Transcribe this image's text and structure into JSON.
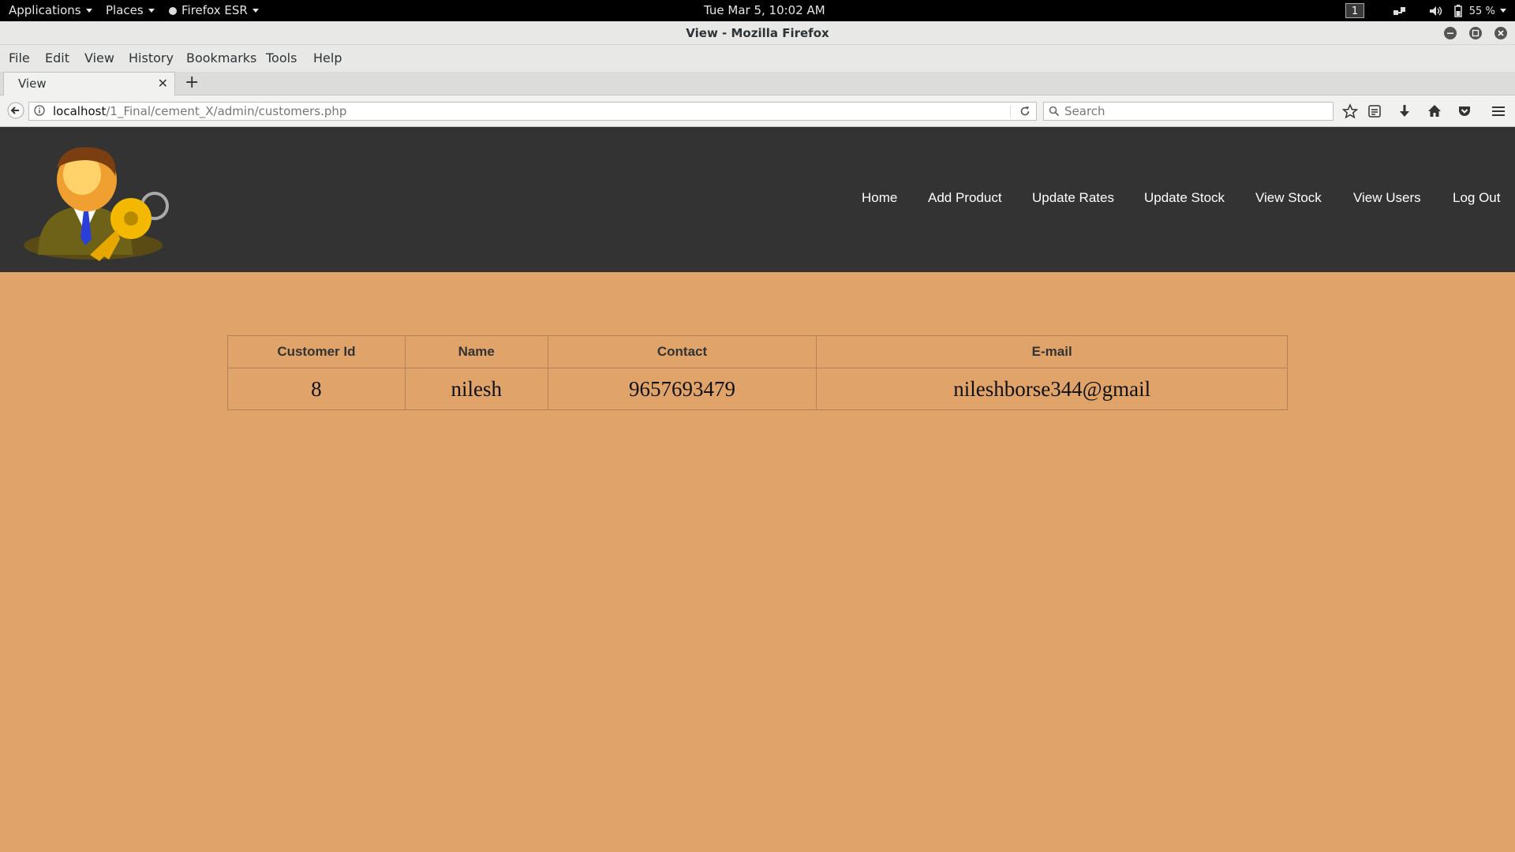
{
  "system_bar": {
    "applications": "Applications",
    "places": "Places",
    "firefox": "Firefox ESR",
    "clock": "Tue Mar  5, 10:02 AM",
    "workspace": "1",
    "battery": "55 %"
  },
  "window": {
    "title": "View - Mozilla Firefox"
  },
  "menubar": {
    "items": [
      "File",
      "Edit",
      "View",
      "History",
      "Bookmarks",
      "Tools",
      "Help"
    ]
  },
  "tabs": [
    {
      "label": "View"
    }
  ],
  "navbar": {
    "url_host": "localhost",
    "url_path": "/1_Final/cement_X/admin/customers.php",
    "search_placeholder": "Search"
  },
  "site": {
    "nav": [
      "Home",
      "Add Product",
      "Update Rates",
      "Update Stock",
      "View Stock",
      "View Users",
      "Log Out"
    ]
  },
  "customers_table": {
    "headers": [
      "Customer Id",
      "Name",
      "Contact",
      "E-mail"
    ],
    "rows": [
      [
        "8",
        "nilesh",
        "9657693479",
        "nileshborse344@gmail"
      ]
    ]
  },
  "colors": {
    "page_background": "#e0a369",
    "header_background": "#333333"
  }
}
